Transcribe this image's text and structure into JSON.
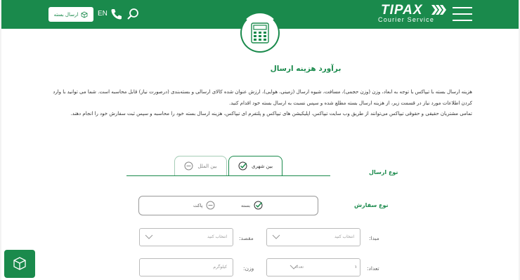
{
  "header": {
    "logo_text": "TIPAX",
    "logo_subtitle": "Courier Service",
    "send_button_label": "ارسال بسته",
    "language_label": "EN"
  },
  "hero": {
    "title": "برآورد هزینه ارسال"
  },
  "description": {
    "paragraph_1": "هزینه ارسال بسته با تیپاکس با توجه به ابعاد، وزن (وزن حجمی)، مسافت، شیوه ارسال (زمینی، هوایی)، ارزش عنوان شده کالای ارسالی و بسته‌بندی (درصورت نیاز) قابل محاسبه است. شما می توانید با وارد کردن اطلاعات مورد نیاز در قسمت زیر، از هزینه ارسال بسته مطلع شده و سپس نسبت به ارسال بسته خود اقدام کنید.",
    "paragraph_2": "تمامی مشتریان حقیقی و حقوقی تیپاکس می‌توانند از طریق وب سایت تیپاکس، اپلیکیشن های تیپاکس و پلتفرم ای تیپاکس، هزینه ارسال بسته خود را محاسبه و سپس ثبت سفارش خود را انجام دهند."
  },
  "shipping_type": {
    "label": "نوع ارسال",
    "tabs": [
      {
        "label": "بین شهری",
        "active": true
      },
      {
        "label": "بین الملل",
        "active": false
      }
    ]
  },
  "order_type": {
    "label": "نوع سفارش",
    "options": [
      {
        "label": "بسته",
        "selected": true
      },
      {
        "label": "پاکت",
        "selected": false
      }
    ]
  },
  "form": {
    "origin_label": "مبدا:",
    "origin_placeholder": "انتخاب کنید",
    "destination_label": "مقصد:",
    "destination_placeholder": "انتخاب کنید",
    "count_label": "تعداد:",
    "count_value": "۱",
    "count_unit": "تعداد",
    "weight_label": "وزن:",
    "weight_placeholder": "کیلوگرم"
  },
  "colors": {
    "brand_green": "#1a8a4c"
  }
}
